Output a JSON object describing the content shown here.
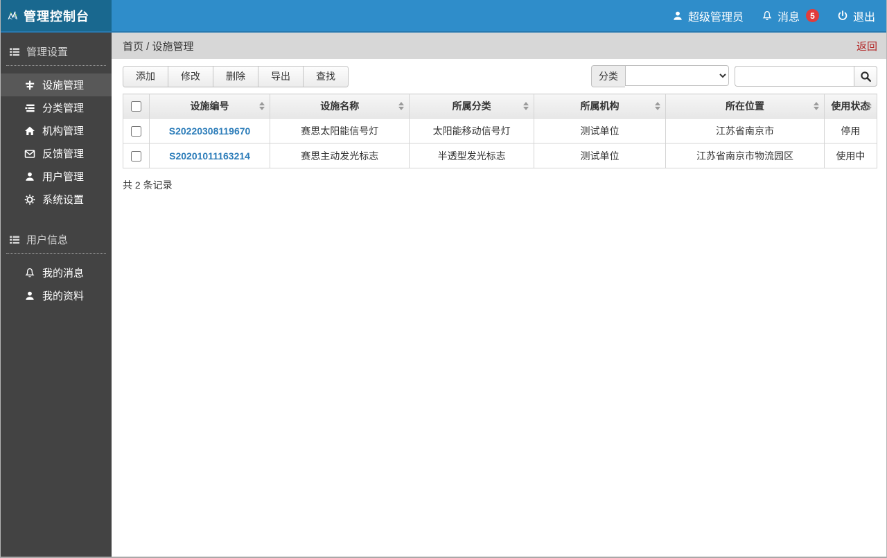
{
  "topbar": {
    "brand": "管理控制台",
    "user": "超级管理员",
    "messages_label": "消息",
    "messages_count": "5",
    "logout_label": "退出"
  },
  "sidebar": {
    "sections": [
      {
        "title": "管理设置",
        "items": [
          {
            "label": "设施管理",
            "icon": "road-icon",
            "active": true
          },
          {
            "label": "分类管理",
            "icon": "category-icon",
            "active": false
          },
          {
            "label": "机构管理",
            "icon": "home-icon",
            "active": false
          },
          {
            "label": "反馈管理",
            "icon": "envelope-icon",
            "active": false
          },
          {
            "label": "用户管理",
            "icon": "user-icon",
            "active": false
          },
          {
            "label": "系统设置",
            "icon": "gear-icon",
            "active": false
          }
        ]
      },
      {
        "title": "用户信息",
        "items": [
          {
            "label": "我的消息",
            "icon": "bell-icon",
            "active": false
          },
          {
            "label": "我的资料",
            "icon": "user-icon",
            "active": false
          }
        ]
      }
    ]
  },
  "breadcrumb": {
    "path": "首页 / 设施管理",
    "back_label": "返回"
  },
  "toolbar": {
    "buttons": [
      "添加",
      "修改",
      "删除",
      "导出",
      "查找"
    ],
    "filter_label": "分类",
    "search_value": "",
    "select_value": ""
  },
  "table": {
    "headers": [
      "设施编号",
      "设施名称",
      "所属分类",
      "所属机构",
      "所在位置",
      "使用状态"
    ],
    "rows": [
      {
        "id": "S20220308119670",
        "name": "赛思太阳能信号灯",
        "category": "太阳能移动信号灯",
        "org": "测试单位",
        "location": "江苏省南京市",
        "status": "停用"
      },
      {
        "id": "S20201011163214",
        "name": "赛思主动发光标志",
        "category": "半透型发光标志",
        "org": "测试单位",
        "location": "江苏省南京市物流园区",
        "status": "使用中"
      }
    ]
  },
  "footer": {
    "record_count": "共 2 条记录"
  },
  "colors": {
    "topbar_blue": "#2f8dca",
    "brand_teal": "#19688f",
    "sidebar_dark": "#434343",
    "sidebar_active": "#585858",
    "breadcrumb_grey": "#d7d7d7",
    "back_red": "#b22222",
    "badge_red": "#e03c3c",
    "link_blue": "#2b7cb9"
  }
}
